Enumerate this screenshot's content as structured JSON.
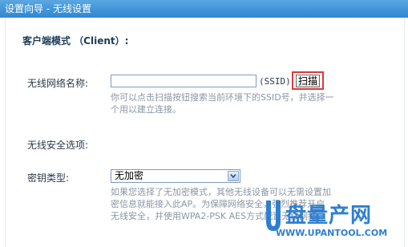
{
  "window": {
    "title": "设置向导 - 无线设置"
  },
  "mode": {
    "heading": "客户端模式  （Client）:"
  },
  "ssid": {
    "label": "无线网络名称:",
    "value": "",
    "suffix": "(SSID)",
    "scan_label": "扫描",
    "help": "你可以点击扫描按钮搜索当前环境下的SSID号，并选择一个用以建立连接。"
  },
  "security": {
    "heading": "无线安全选项:",
    "key_type_label": "密钥类型:",
    "key_type_value": "无加密",
    "help": "如果您选择了无加密模式，其他无线设备可以无需设置加密信息就能接入此AP。为保障网络安全，强烈推荐开启无线安全，并使用WPA2-PSK AES方式配置无线网络。"
  },
  "watermark": {
    "brand": "盘量产网",
    "url": "WWW.UPANTOOL.COM"
  },
  "colors": {
    "title_bar": "#3a8fd6",
    "accent_border": "#d93a3a",
    "help_text": "#8a96a3"
  }
}
